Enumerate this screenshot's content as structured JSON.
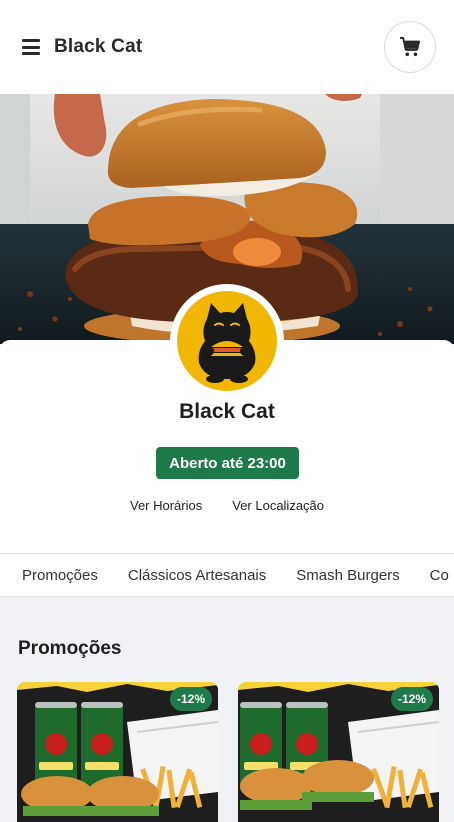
{
  "header": {
    "title": "Black Cat",
    "menu_icon": "menu-icon",
    "cart_icon": "cart-icon"
  },
  "store": {
    "name": "Black Cat",
    "status": "Aberto até 23:00",
    "status_color": "#1e7a4a",
    "hours_link": "Ver Horários",
    "location_link": "Ver Localização",
    "logo_color": "#f2b705"
  },
  "tabs": [
    {
      "label": "Promoções"
    },
    {
      "label": "Clássicos Artesanais"
    },
    {
      "label": "Smash Burgers"
    },
    {
      "label": "Co"
    }
  ],
  "section": {
    "title": "Promoções"
  },
  "products": [
    {
      "discount": "-12%"
    },
    {
      "discount": "-12%"
    }
  ]
}
